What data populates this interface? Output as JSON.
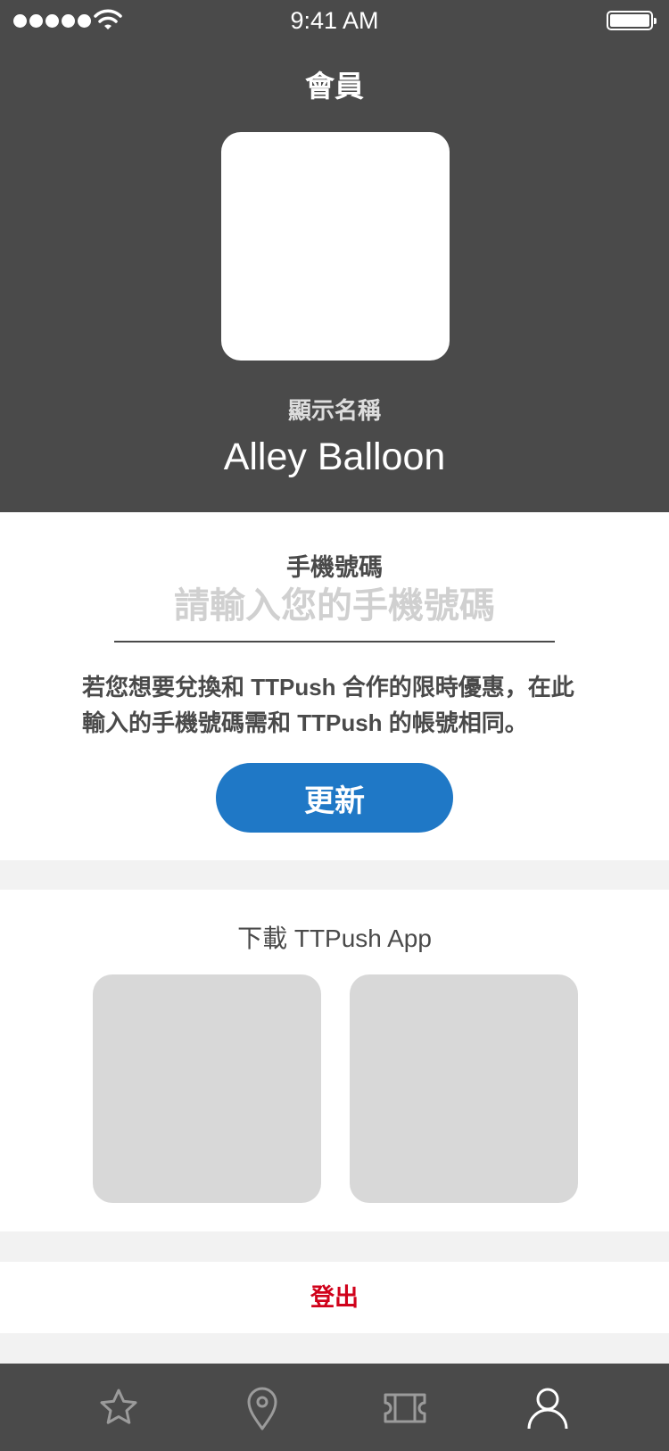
{
  "status_bar": {
    "time": "9:41 AM"
  },
  "header": {
    "title": "會員"
  },
  "profile": {
    "display_label": "顯示名稱",
    "display_name": "Alley Balloon"
  },
  "phone": {
    "label": "手機號碼",
    "placeholder": "請輸入您的手機號碼",
    "value": "",
    "note": "若您想要兌換和 TTPush 合作的限時優惠，在此輸入的手機號碼需和 TTPush 的帳號相同。",
    "update_label": "更新"
  },
  "download": {
    "title": "下載 TTPush App"
  },
  "logout_label": "登出",
  "colors": {
    "header_bg": "#4a4a4a",
    "accent": "#1f78c6",
    "danger": "#d0021b",
    "page_bg": "#f2f2f2"
  },
  "tabbar": {
    "items": [
      {
        "icon": "star-icon",
        "active": false
      },
      {
        "icon": "location-pin-icon",
        "active": false
      },
      {
        "icon": "ticket-icon",
        "active": false
      },
      {
        "icon": "person-icon",
        "active": true
      }
    ]
  }
}
